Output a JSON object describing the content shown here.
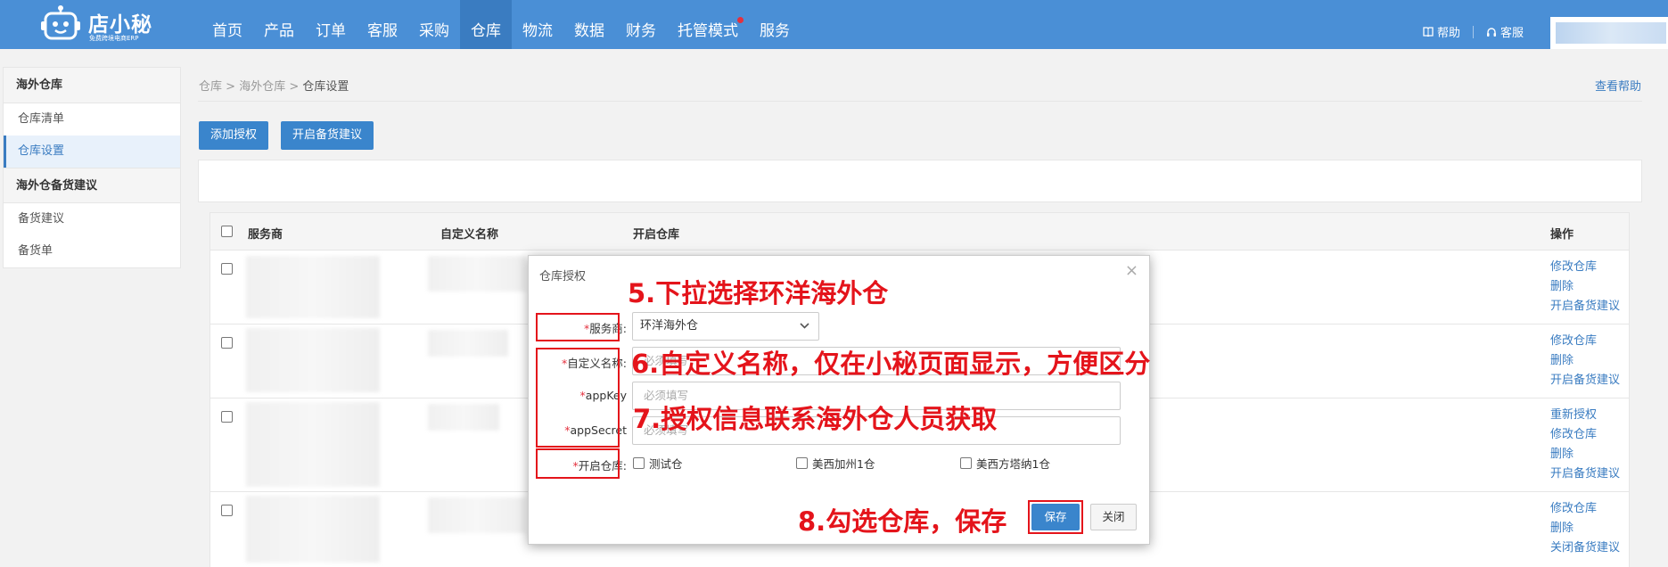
{
  "header": {
    "logo_name": "店小秘",
    "logo_sub": "免费跨境电商ERP",
    "nav": [
      "首页",
      "产品",
      "订单",
      "客服",
      "采购",
      "仓库",
      "物流",
      "数据",
      "财务",
      "托管模式",
      "服务"
    ],
    "active_nav": "仓库",
    "help_label": "帮助",
    "service_label": "客服"
  },
  "sidebar": {
    "group1": "海外仓库",
    "group1_items": [
      "仓库清单",
      "仓库设置"
    ],
    "group2": "海外仓备货建议",
    "group2_items": [
      "备货建议",
      "备货单"
    ]
  },
  "breadcrumb": {
    "level1": "仓库",
    "level2": "海外仓库",
    "current": "仓库设置"
  },
  "help_link": "查看帮助",
  "toolbar": {
    "add_auth": "添加授权",
    "restock": "开启备货建议"
  },
  "table": {
    "headers": {
      "provider": "服务商",
      "custom_name": "自定义名称",
      "warehouses": "开启仓库",
      "ops": "操作"
    },
    "rows": [
      {
        "ops": [
          "修改仓库",
          "删除",
          "开启备货建议"
        ]
      },
      {
        "ops": [
          "修改仓库",
          "删除",
          "开启备货建议"
        ]
      },
      {
        "ops": [
          "重新授权",
          "修改仓库",
          "删除",
          "开启备货建议"
        ]
      },
      {
        "ops": [
          "修改仓库",
          "删除",
          "关闭备货建议"
        ]
      }
    ]
  },
  "modal": {
    "title": "仓库授权",
    "provider_label": "服务商:",
    "provider_value": "环洋海外仓",
    "custom_name_label": "自定义名称:",
    "appkey_label": "appKey",
    "appsecret_label": "appSecret",
    "required_placeholder": "必须填写",
    "warehouses_label": "开启仓库:",
    "warehouse_options": [
      "测试仓",
      "美西加州1仓",
      "美西方塔纳1仓"
    ],
    "save": "保存",
    "close": "关闭"
  },
  "annotations": {
    "step5": "5.下拉选择环洋海外仓",
    "step6": "6.自定义名称，仅在小秘页面显示，方便区分",
    "step7": "7.授权信息联系海外仓人员获取",
    "step8": "8.勾选仓库，保存"
  },
  "colors": {
    "brand_blue": "#4a8fd6",
    "annotation_red": "#e4141b",
    "link_blue": "#3a7cc1"
  }
}
